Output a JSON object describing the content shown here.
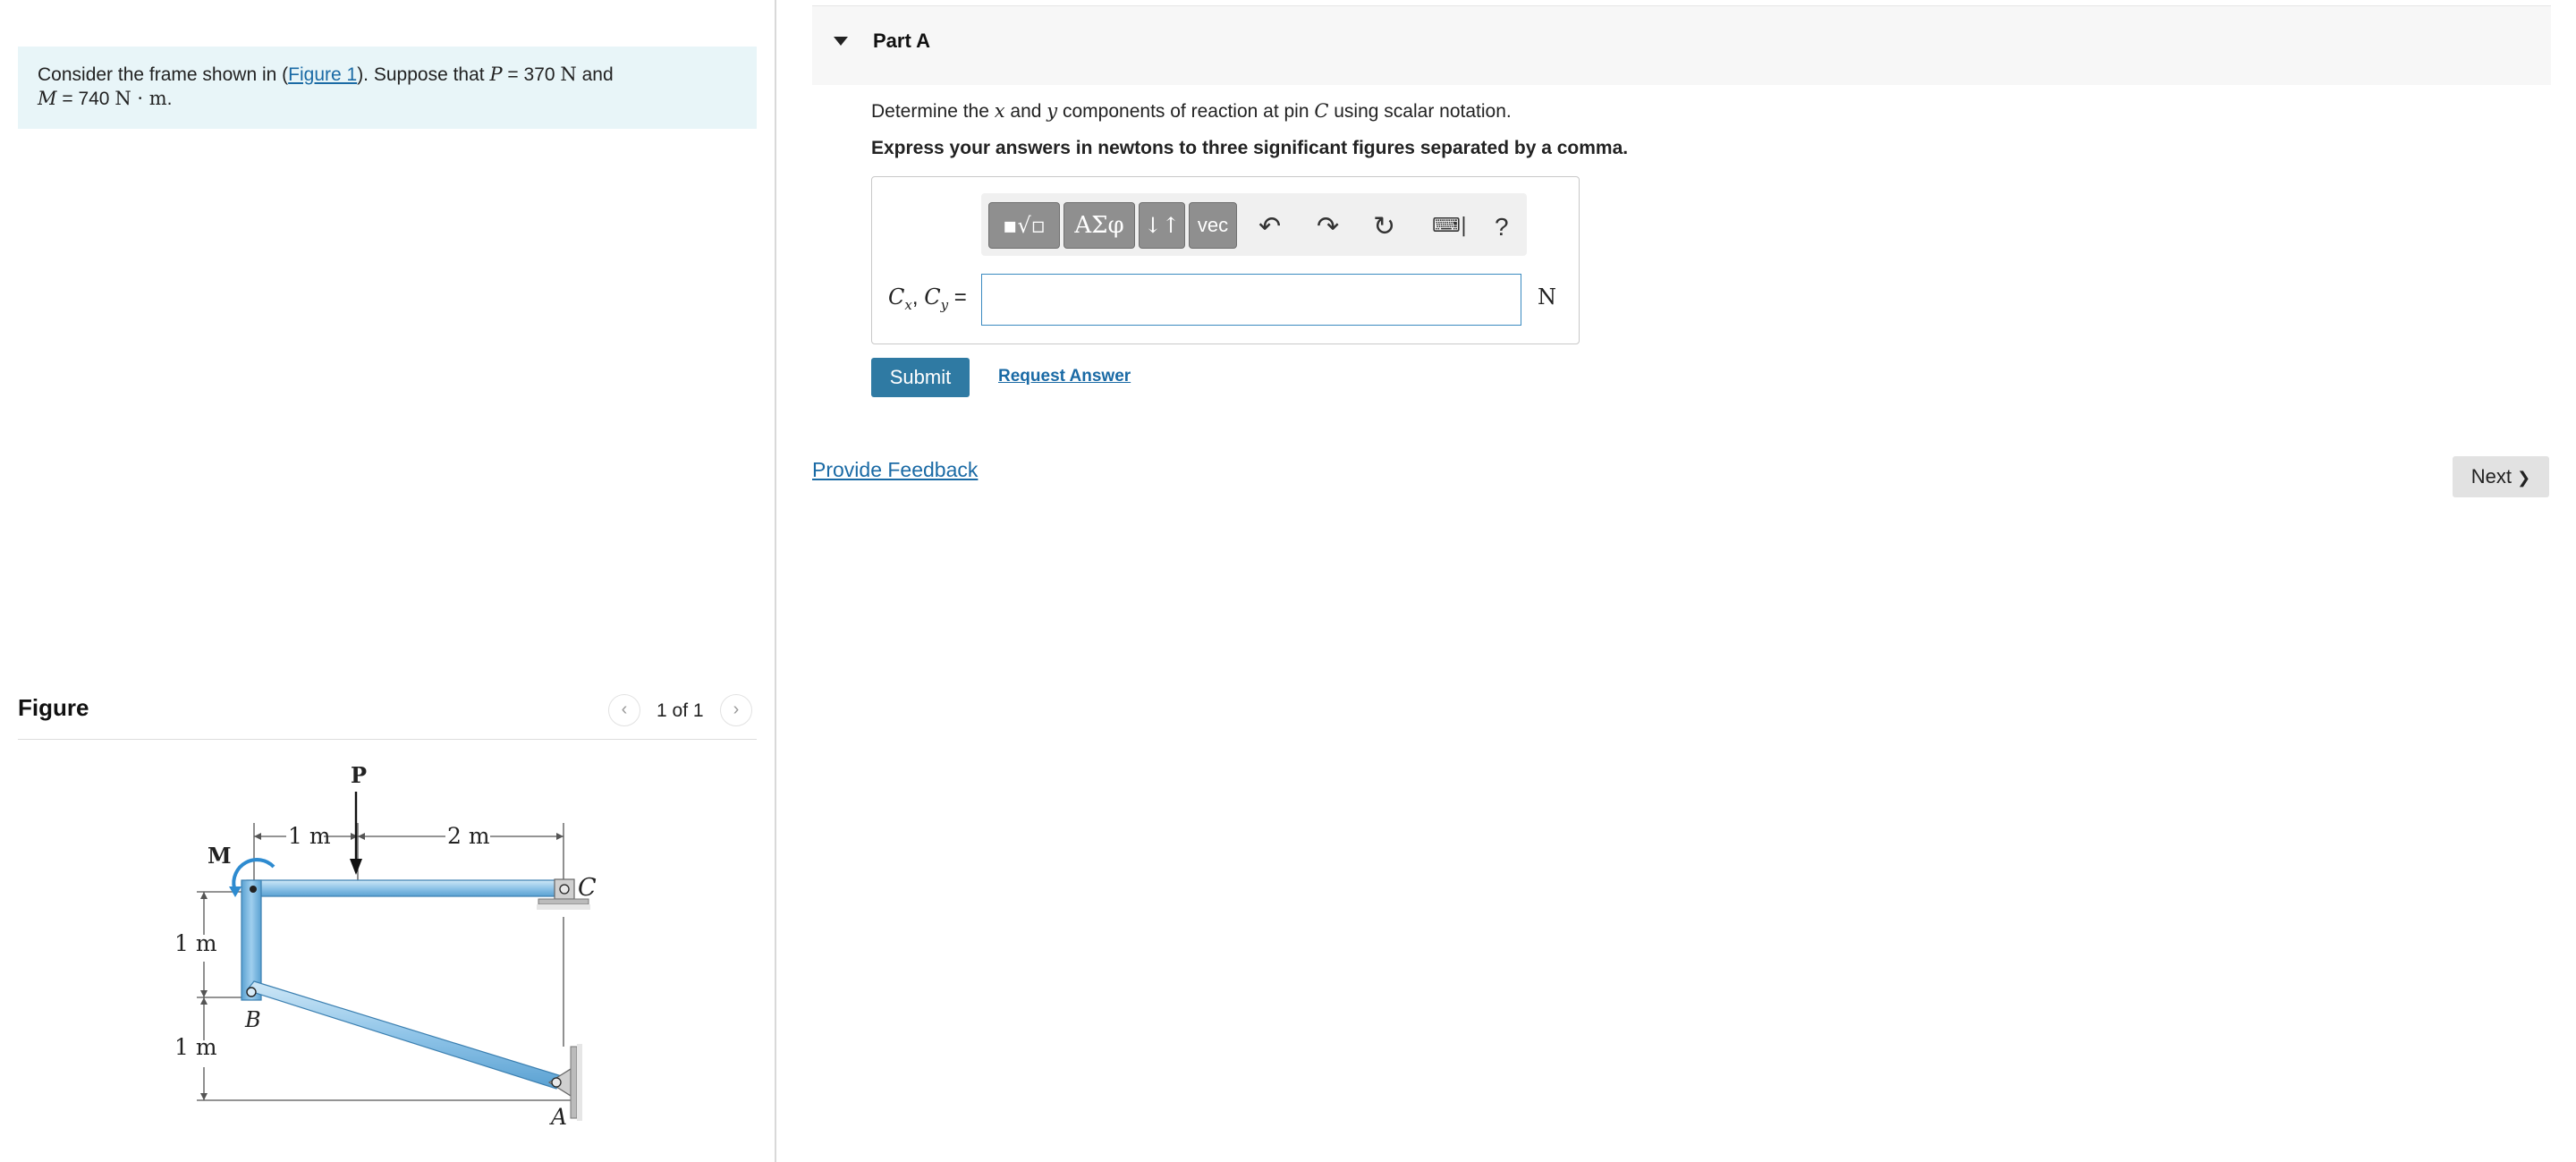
{
  "problem": {
    "text_pre": "Consider the frame shown in (",
    "figure_link": "Figure 1",
    "text_mid": "). Suppose that ",
    "P_symbol": "P",
    "P_value": " = 370 ",
    "P_unit": "N",
    "text_and": " and",
    "M_symbol": "M",
    "M_value": " = 740 ",
    "M_unit": "N · m",
    "end": "."
  },
  "figure": {
    "title": "Figure",
    "pagination": "1 of 1",
    "prev_glyph": "‹",
    "next_glyph": "›",
    "labels": {
      "P": "P",
      "M": "M",
      "dim_top_left": "1 m",
      "dim_top_right": "2 m",
      "dim_left_upper": "1 m",
      "dim_left_lower": "1 m",
      "B": "B",
      "C": "C",
      "A": "A"
    }
  },
  "part": {
    "title": "Part A",
    "question_pre": "Determine the ",
    "x": "x",
    "and": " and ",
    "y": "y",
    "question_mid": " components of reaction at pin ",
    "C": "C",
    "question_post": " using scalar notation.",
    "instruction": "Express your answers in newtons to three significant figures separated by a comma."
  },
  "toolbar": {
    "templates": "▪√▫",
    "greek": "ΑΣφ",
    "subscript": "↓↑",
    "vector": "vec",
    "undo": "↶",
    "redo": "↷",
    "reset": "↻",
    "keyboard": "⌨|",
    "help": "?"
  },
  "answer": {
    "label_C1": "C",
    "label_sub1": "x",
    "label_comma": ", ",
    "label_C2": "C",
    "label_sub2": "y",
    "label_eq": " =",
    "value": "",
    "unit": "N"
  },
  "actions": {
    "submit": "Submit",
    "request_answer": "Request Answer",
    "provide_feedback": "Provide Feedback",
    "next": "Next",
    "next_chevron": "❯"
  }
}
